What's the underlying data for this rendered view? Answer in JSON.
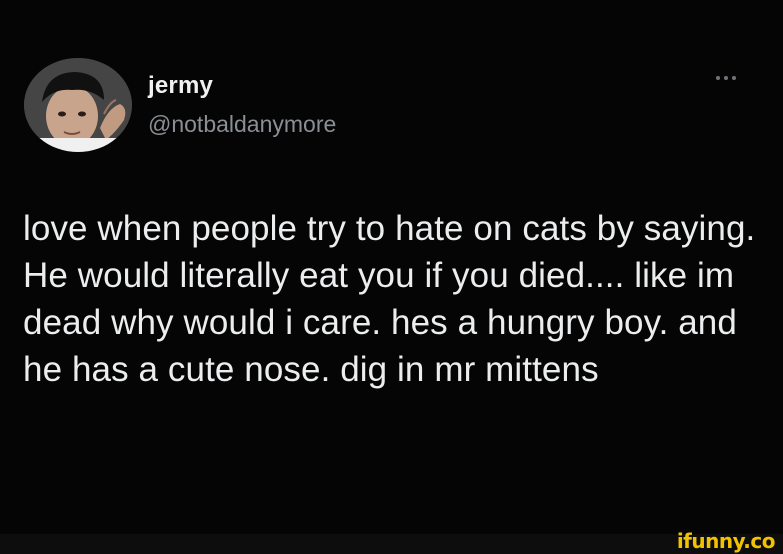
{
  "tweet": {
    "author": {
      "display_name": "jermy",
      "handle": "@notbaldanymore",
      "avatar_icon": "user-avatar-icon"
    },
    "more_icon": "more-options-icon",
    "text": "love when people try to hate on cats by saying. He would literally eat you if you died.... like im dead why would i care. hes a hungry boy. and he has a cute nose. dig in mr mittens"
  },
  "watermark": {
    "text": "ifunny.co",
    "color": "#f2c200"
  },
  "colors": {
    "background": "#050505",
    "text": "#ecedee",
    "handle": "#8b8f94"
  }
}
